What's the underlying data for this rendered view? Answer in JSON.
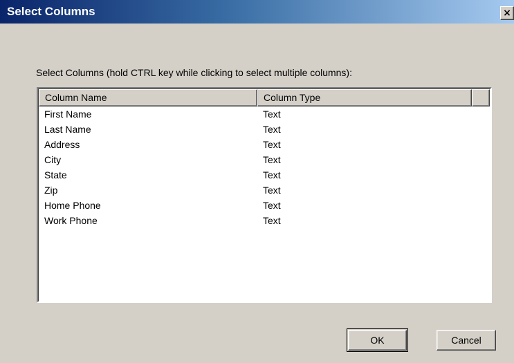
{
  "window": {
    "title": "Select Columns",
    "close_glyph": "×"
  },
  "instructions": "Select Columns (hold CTRL key while clicking to select multiple columns):",
  "list": {
    "headers": {
      "name": "Column Name",
      "type": "Column Type"
    },
    "rows": [
      {
        "name": "First Name",
        "type": "Text"
      },
      {
        "name": "Last Name",
        "type": "Text"
      },
      {
        "name": "Address",
        "type": "Text"
      },
      {
        "name": "City",
        "type": "Text"
      },
      {
        "name": "State",
        "type": "Text"
      },
      {
        "name": "Zip",
        "type": "Text"
      },
      {
        "name": "Home Phone",
        "type": "Text"
      },
      {
        "name": "Work Phone",
        "type": "Text"
      }
    ]
  },
  "buttons": {
    "ok": "OK",
    "cancel": "Cancel"
  },
  "colors": {
    "titlebar_start": "#0a246a",
    "titlebar_end": "#a6caf0",
    "face": "#d4d0c8"
  }
}
